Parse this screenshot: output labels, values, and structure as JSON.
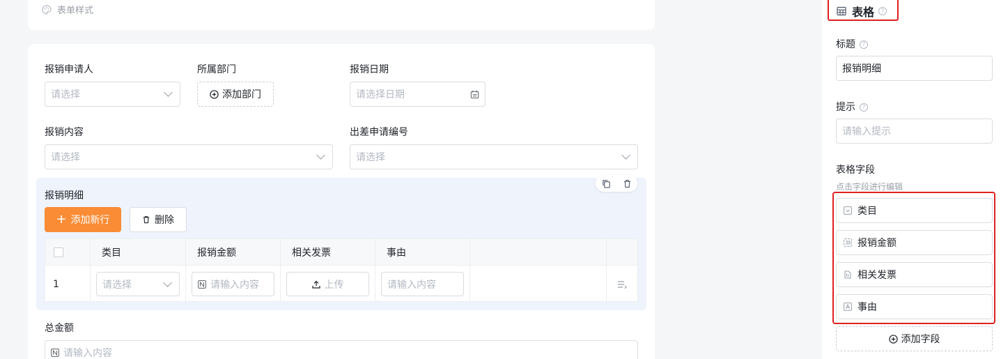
{
  "form_style_card": {
    "label": "表单样式"
  },
  "form": {
    "applicant": {
      "label": "报销申请人",
      "placeholder": "请选择"
    },
    "department": {
      "label": "所属部门",
      "button": "添加部门"
    },
    "date": {
      "label": "报销日期",
      "placeholder": "请选择日期"
    },
    "content": {
      "label": "报销内容",
      "placeholder": "请选择"
    },
    "travel_no": {
      "label": "出差申请编号",
      "placeholder": "请选择"
    },
    "total": {
      "label": "总金额",
      "placeholder": "请输入内容"
    }
  },
  "detail_table": {
    "title": "报销明细",
    "add_row": "添加新行",
    "delete": "删除",
    "columns": [
      "类目",
      "报销金额",
      "相关发票",
      "事由"
    ],
    "row": {
      "index": "1",
      "category_placeholder": "请选择",
      "amount_placeholder": "请输入内容",
      "upload": "上传",
      "reason_placeholder": "请输入内容"
    }
  },
  "props_panel": {
    "component_title": "表格",
    "title_label": "标题",
    "title_value": "报销明细",
    "hint_label": "提示",
    "hint_placeholder": "请输入提示",
    "fields_label": "表格字段",
    "fields_hint": "点击字段进行编辑",
    "fields": [
      "类目",
      "报销金额",
      "相关发票",
      "事由"
    ],
    "add_field": "添加字段",
    "help_glyph": "?"
  },
  "colors": {
    "accent": "#fa8c35",
    "selected_bg": "#eef3fc",
    "highlight_border": "#e02020"
  }
}
